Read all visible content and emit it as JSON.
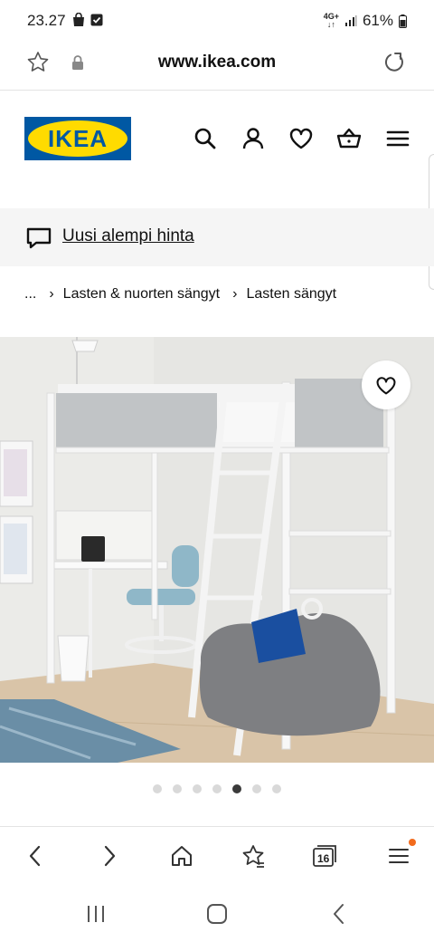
{
  "status_bar": {
    "time": "23.27",
    "network": "4G+",
    "battery": "61%",
    "icons": [
      "shopping-bag-icon",
      "checkbox-icon",
      "signal-icon",
      "battery-icon"
    ]
  },
  "browser": {
    "url": "www.ikea.com",
    "tab_count": "16",
    "accent_badge_color": "#f26b1d"
  },
  "header": {
    "logo_text": "IKEA",
    "logo_colors": {
      "blue": "#0058a3",
      "yellow": "#ffdb00"
    },
    "icons": [
      "search-icon",
      "account-icon",
      "heart-icon",
      "basket-icon",
      "hamburger-menu-icon"
    ]
  },
  "promo": {
    "label": "Uusi alempi hinta",
    "icon": "speech-bubble-icon"
  },
  "breadcrumb": {
    "ellipsis": "...",
    "items": [
      "Lasten & nuorten sängyt",
      "Lasten sängyt"
    ]
  },
  "gallery": {
    "total_images": 7,
    "active_index": 4
  }
}
